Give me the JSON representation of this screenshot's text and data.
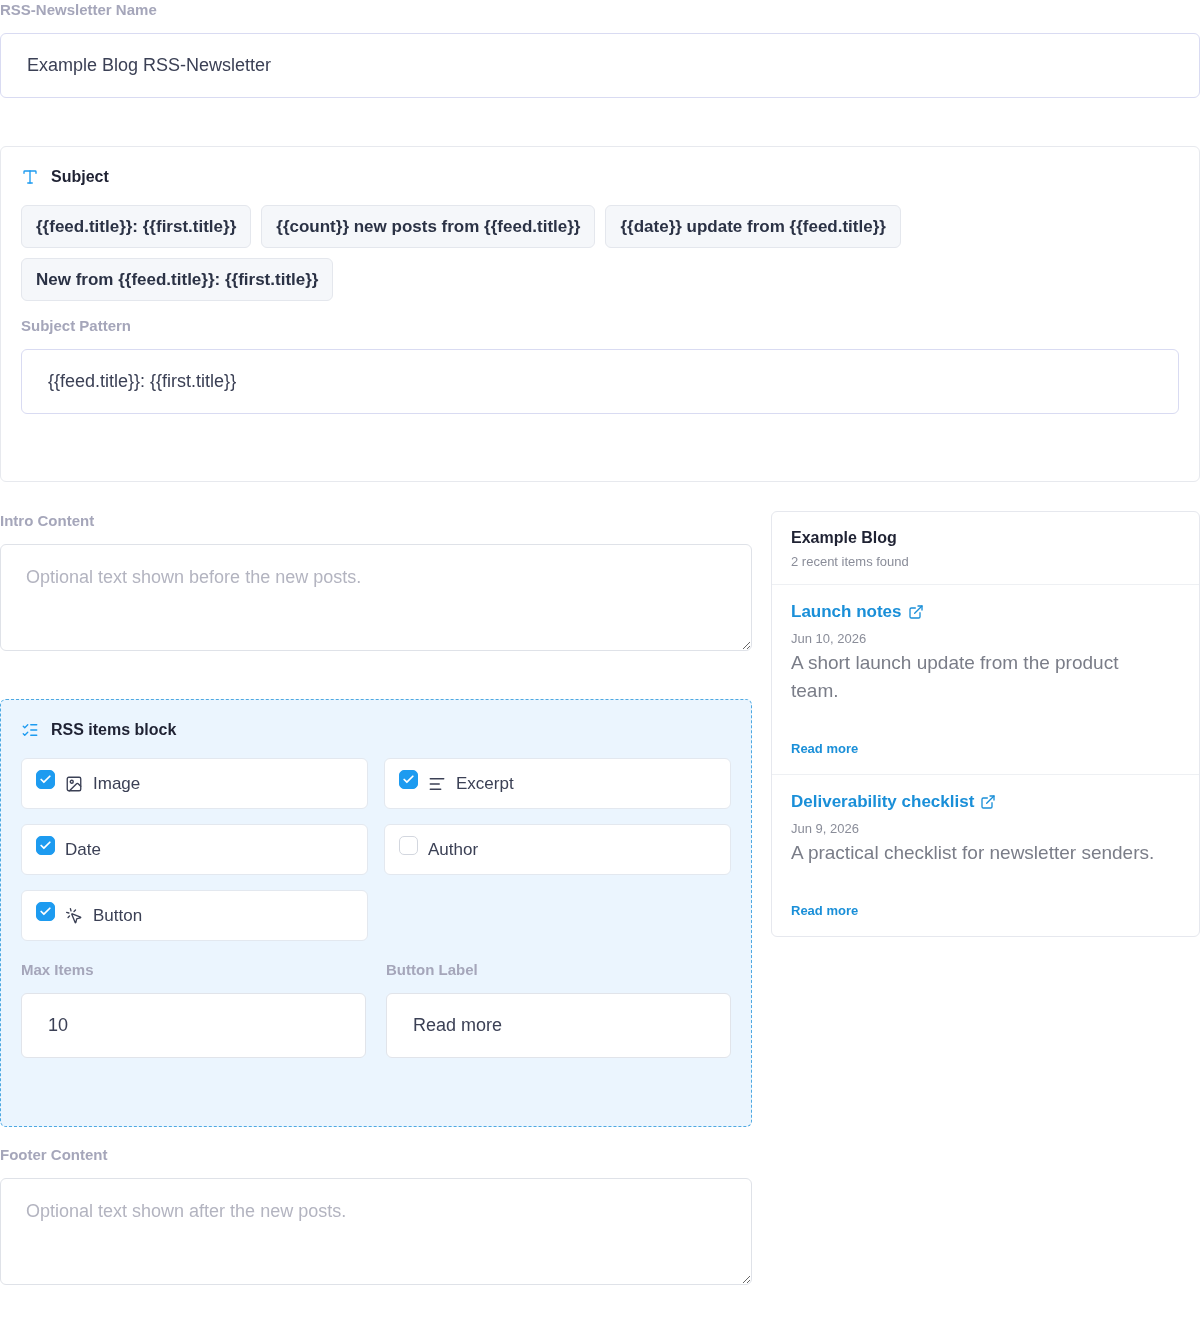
{
  "name_field": {
    "label": "RSS-Newsletter Name",
    "value": "Example Blog RSS-Newsletter"
  },
  "subject": {
    "title": "Subject",
    "presets": [
      "{{feed.title}}: {{first.title}}",
      "{{count}} new posts from {{feed.title}}",
      "{{date}} update from {{feed.title}}",
      "New from {{feed.title}}: {{first.title}}"
    ],
    "pattern": {
      "label": "Subject Pattern",
      "value": "{{feed.title}}: {{first.title}}"
    }
  },
  "intro": {
    "label": "Intro Content",
    "placeholder": "Optional text shown before the new posts."
  },
  "rss_block": {
    "title": "RSS items block",
    "options": [
      {
        "label": "Image",
        "kind": "image",
        "checked": true
      },
      {
        "label": "Excerpt",
        "kind": "excerpt",
        "checked": true
      },
      {
        "label": "Date",
        "kind": "plain",
        "checked": true
      },
      {
        "label": "Author",
        "kind": "plain",
        "checked": false
      },
      {
        "label": "Button",
        "kind": "button",
        "checked": true
      }
    ],
    "max_items": {
      "label": "Max Items",
      "value": "10"
    },
    "button_label": {
      "label": "Button Label",
      "value": "Read more"
    }
  },
  "footer": {
    "label": "Footer Content",
    "placeholder": "Optional text shown after the new posts."
  },
  "preview": {
    "title": "Example Blog",
    "subtitle": "2 recent items found",
    "items": [
      {
        "title": "Launch notes",
        "date": "Jun 10, 2026",
        "excerpt": "A short launch update from the product team.",
        "link": "Read more"
      },
      {
        "title": "Deliverability checklist",
        "date": "Jun 9, 2026",
        "excerpt": "A practical checklist for newsletter senders.",
        "link": "Read more"
      }
    ]
  }
}
